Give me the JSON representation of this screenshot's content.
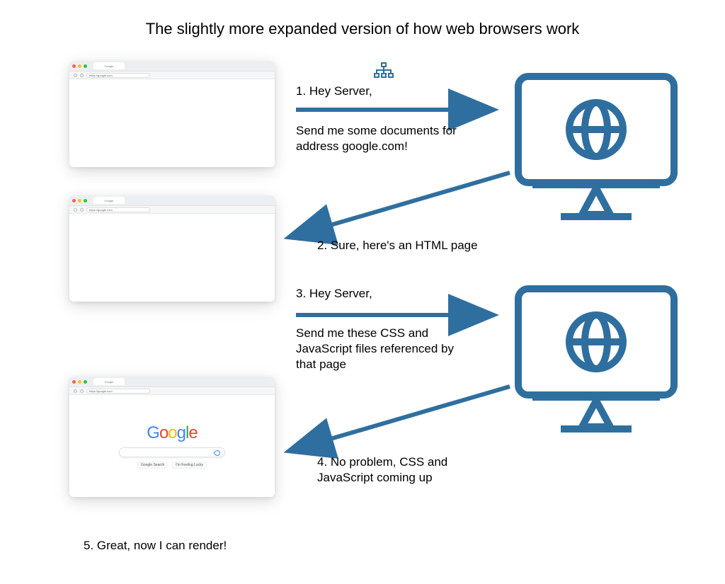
{
  "title": "The slightly more expanded version of how web browsers work",
  "browser": {
    "tab_label": "Google",
    "url": "https://google.com",
    "google_buttons": {
      "search": "Google Search",
      "lucky": "I'm Feeling Lucky"
    }
  },
  "steps": {
    "s1a": "1. Hey Server,",
    "s1b": "Send me some documents for address google.com!",
    "s2": "2. Sure, here's an HTML page",
    "s3a": "3. Hey Server,",
    "s3b": "Send me these CSS and JavaScript files referenced by that page",
    "s4": "4. No problem, CSS and JavaScript coming up",
    "s5": "5. Great, now I can render!"
  },
  "colors": {
    "accent": "#2F6F9F"
  }
}
